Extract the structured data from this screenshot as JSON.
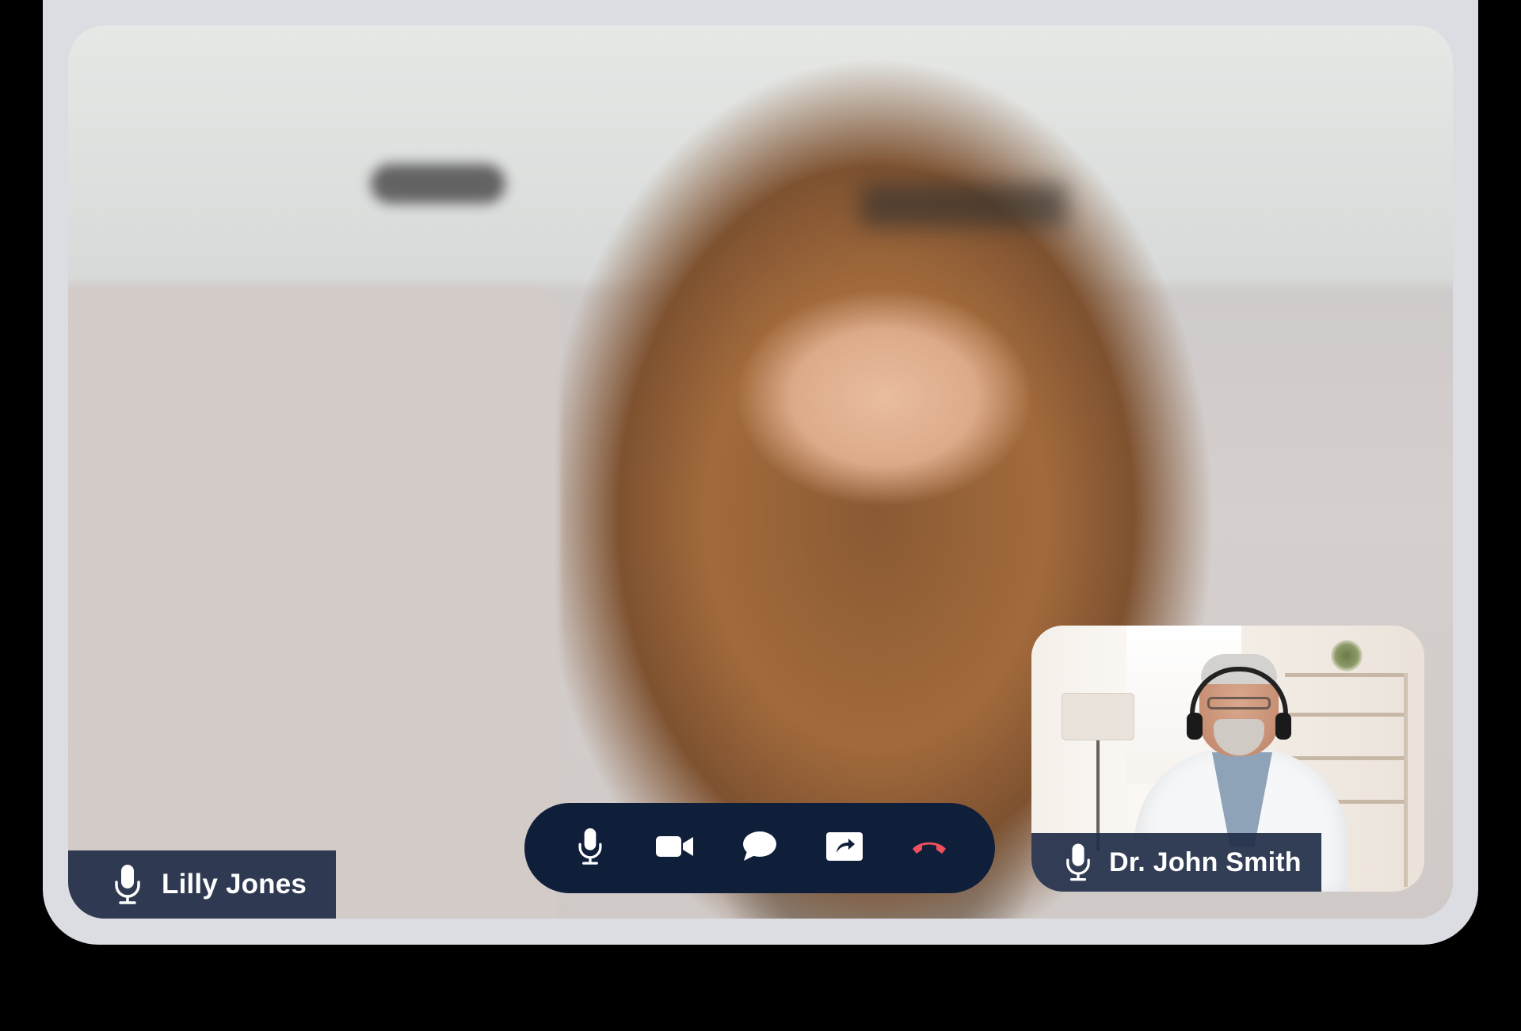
{
  "call": {
    "main_participant": {
      "name": "Lilly Jones",
      "mic_icon": "microphone-icon"
    },
    "pip_participant": {
      "name": "Dr. John Smith",
      "mic_icon": "microphone-icon"
    },
    "controls": [
      {
        "name": "microphone",
        "icon": "microphone-icon",
        "color": "#ffffff"
      },
      {
        "name": "camera",
        "icon": "video-camera-icon",
        "color": "#ffffff"
      },
      {
        "name": "chat",
        "icon": "chat-bubble-icon",
        "color": "#ffffff"
      },
      {
        "name": "share",
        "icon": "share-icon",
        "color": "#ffffff"
      },
      {
        "name": "end-call",
        "icon": "end-call-icon",
        "color": "#f0505a"
      }
    ]
  },
  "colors": {
    "frame": "#dcdde3",
    "control_bar": "#0f1f3a",
    "name_tag": "#212e48",
    "end_call": "#f0505a"
  }
}
